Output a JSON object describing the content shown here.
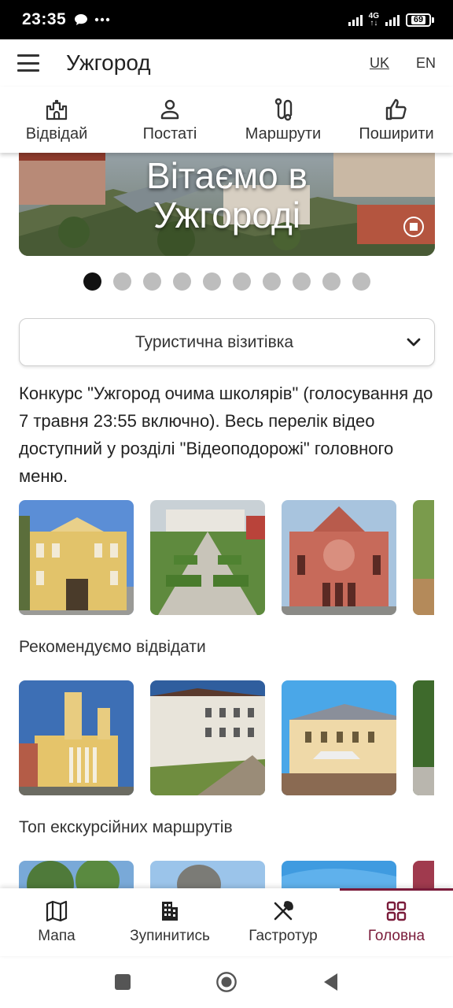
{
  "status_bar": {
    "time": "23:35",
    "network": "4G",
    "battery": "69",
    "icons": [
      "chat-bubble-icon",
      "more-dots-icon",
      "signal-icon",
      "battery-icon"
    ]
  },
  "header": {
    "title": "Ужгород",
    "languages": [
      {
        "code": "UK",
        "active": true
      },
      {
        "code": "EN",
        "active": false
      }
    ]
  },
  "top_nav": {
    "items": [
      {
        "label": "Відвідай",
        "icon": "castle-icon"
      },
      {
        "label": "Постаті",
        "icon": "person-icon"
      },
      {
        "label": "Маршрути",
        "icon": "route-icon"
      },
      {
        "label": "Поширити",
        "icon": "thumbs-up-icon"
      }
    ]
  },
  "banner": {
    "title_line1": "Вітаємо в",
    "title_line2": "Ужгороді",
    "slide_count": 10,
    "active_slide": 1
  },
  "dropdown": {
    "selected": "Туристична візитівка"
  },
  "announcement": {
    "text": "Конкурс \"Ужгород очима школярів\" (голосування до 7 травня 23:55 включно). Весь перелік відео доступний у розділі \"Відеоподорожі\" головного меню."
  },
  "sections": [
    {
      "title": "Рекомендуємо відвідати"
    },
    {
      "title": "Топ екскурсійних маршрутів"
    }
  ],
  "bottom_nav": {
    "items": [
      {
        "label": "Мапа",
        "icon": "map-icon",
        "active": false
      },
      {
        "label": "Зупинитись",
        "icon": "building-icon",
        "active": false
      },
      {
        "label": "Гастротур",
        "icon": "fork-knife-icon",
        "active": false
      },
      {
        "label": "Головна",
        "icon": "grid-icon",
        "active": true
      }
    ]
  },
  "colors": {
    "accent": "#7a1b3a",
    "status_bar": "#000000",
    "dot_inactive": "#bdbdbd",
    "dot_active": "#111111"
  }
}
